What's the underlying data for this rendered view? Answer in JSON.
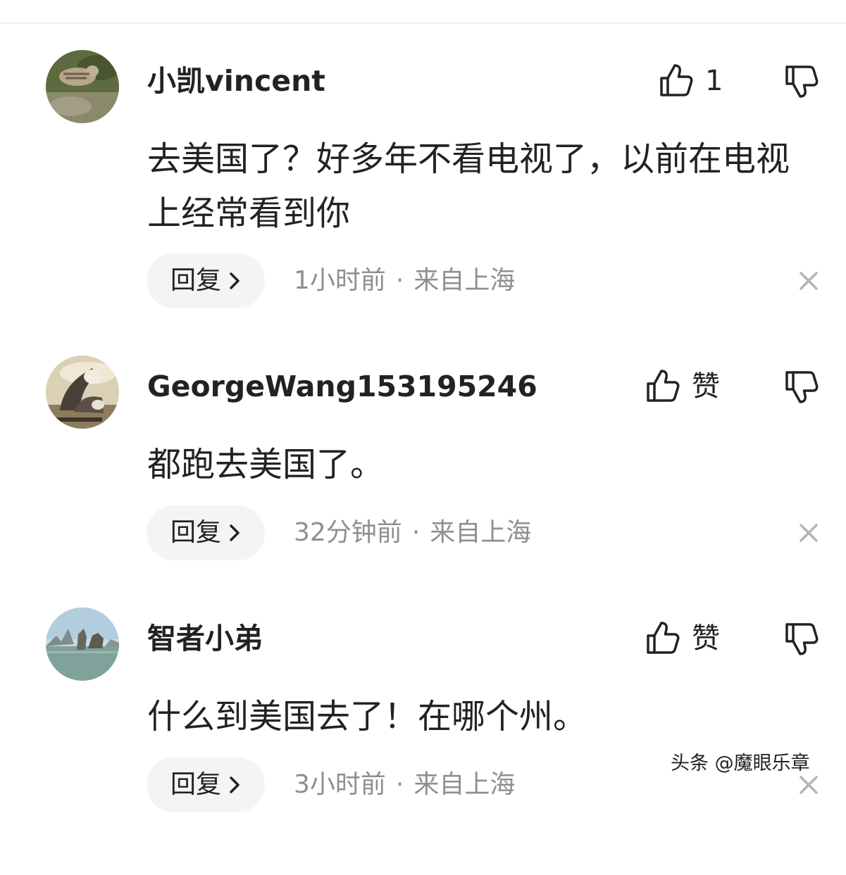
{
  "comments": [
    {
      "username": "小凯vincent",
      "like_text": "1",
      "text": "去美国了？好多年不看电视了，以前在电视上经常看到你",
      "reply_label": "回复",
      "time": "1小时前",
      "separator": "·",
      "location": "来自上海"
    },
    {
      "username": "GeorgeWang153195246",
      "like_text": "赞",
      "text": "都跑去美国了。",
      "reply_label": "回复",
      "time": "32分钟前",
      "separator": "·",
      "location": "来自上海"
    },
    {
      "username": "智者小弟",
      "like_text": "赞",
      "text": "什么到美国去了！在哪个州。",
      "reply_label": "回复",
      "time": "3小时前",
      "separator": "·",
      "location": "来自上海"
    }
  ],
  "watermark": "头条 @魔眼乐章",
  "icons": {
    "like": "thumbs-up-icon",
    "dislike": "thumbs-down-icon",
    "reply_arrow": "chevron-right-icon",
    "dismiss": "close-icon"
  },
  "colors": {
    "text": "#222222",
    "meta": "#8f8f8f",
    "reply_bg": "#f4f4f4",
    "divider": "#eeeeee"
  }
}
